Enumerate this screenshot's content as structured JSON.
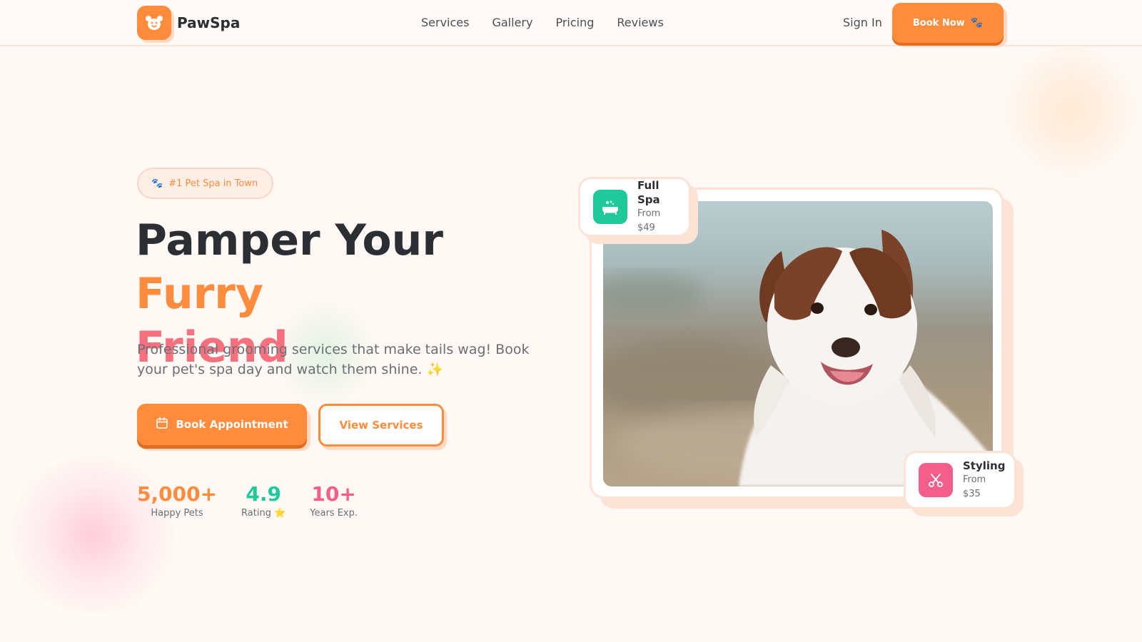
{
  "brand": {
    "name": "PawSpa",
    "logo_icon": "bear-face-icon"
  },
  "nav": {
    "items": [
      {
        "label": "Services"
      },
      {
        "label": "Gallery"
      },
      {
        "label": "Pricing"
      },
      {
        "label": "Reviews"
      }
    ],
    "sign_in": "Sign In",
    "book_now": "Book Now",
    "book_now_icon": "🐾"
  },
  "hero": {
    "badge": {
      "icon": "🐾",
      "text": "#1 Pet Spa in Town"
    },
    "headline": {
      "part1": "Pamper Your ",
      "part2": "Furry",
      "part3": "Friend"
    },
    "subtext": "Professional grooming services that make tails wag! Book your pet's spa day and watch them shine. ✨",
    "primary_button": "Book Appointment",
    "secondary_button": "View Services",
    "stats": [
      {
        "value": "5,000+",
        "label": "Happy Pets",
        "color": "#ff8c3d"
      },
      {
        "value": "4.9",
        "label": "Rating ⭐",
        "color": "#1fc99a"
      },
      {
        "value": "10+",
        "label": "Years Exp.",
        "color": "#f35e8a"
      }
    ]
  },
  "cards": {
    "full_spa": {
      "title": "Full Spa",
      "subtitle": "From $49",
      "icon": "bathtub-icon",
      "color": "#1fc99a"
    },
    "styling": {
      "title": "Styling",
      "subtitle": "From $35",
      "icon": "scissors-icon",
      "color": "#f35e8a"
    }
  },
  "colors": {
    "accent": "#ff8c3d",
    "accent_dark": "#e06d22",
    "pink": "#f7707e",
    "background": "#fff8f4"
  }
}
